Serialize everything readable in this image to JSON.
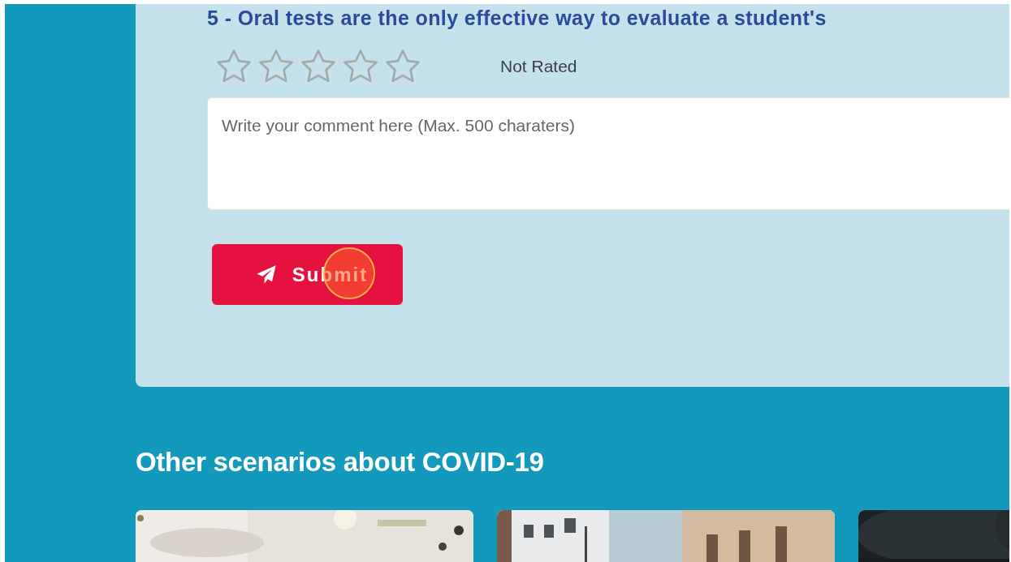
{
  "question": {
    "heading": "5 - Oral tests are the only effective way to evaluate a student's"
  },
  "rating": {
    "stars": 0,
    "label": "Not Rated"
  },
  "comment": {
    "placeholder": "Write your comment here (Max. 500 charaters)"
  },
  "submit": {
    "label": "Submit"
  },
  "other": {
    "title": "Other scenarios about COVID-19"
  }
}
